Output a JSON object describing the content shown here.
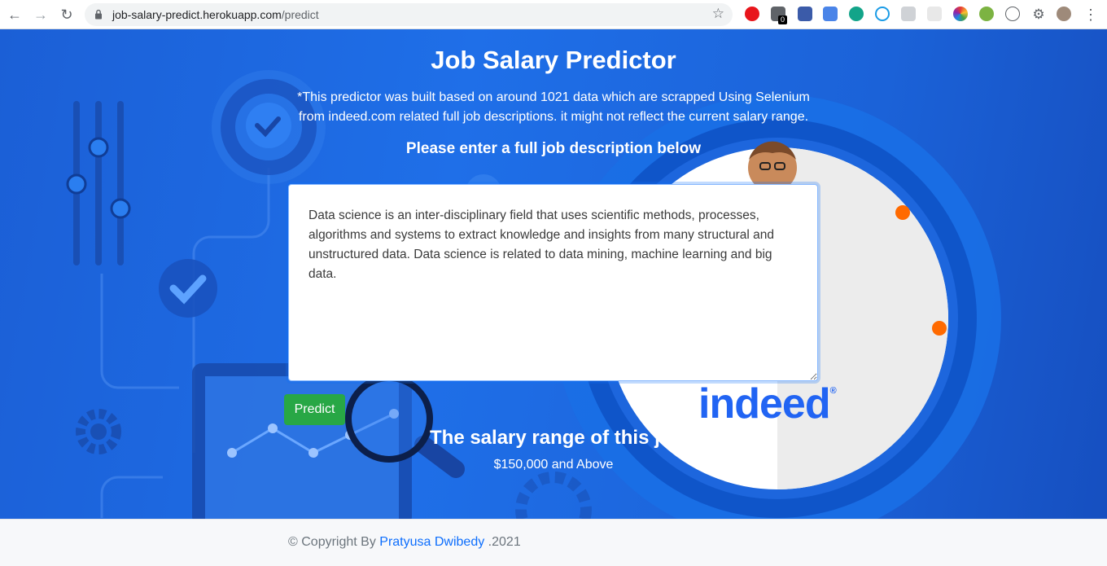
{
  "browser": {
    "url_host": "job-salary-predict.herokuapp.com",
    "url_path": "/predict",
    "extension_badge": "0"
  },
  "page": {
    "title": "Job Salary Predictor",
    "subtitle_line1": "*This predictor was built based on around 1021 data which are scrapped Using Selenium",
    "subtitle_line2": "from indeed.com related full job descriptions. it might not reflect the current salary range.",
    "prompt": "Please enter a full job description below",
    "job_description": "Data science is an inter-disciplinary field that uses scientific methods, processes, algorithms and systems to extract knowledge and insights from many structural and unstructured data. Data science is related to data mining, machine learning and big data.",
    "predict_label": "Predict",
    "result_heading": "The salary range of this j",
    "result_value": "$150,000 and Above",
    "logo_text": "indeed",
    "logo_mark": "®"
  },
  "footer": {
    "prefix": "© Copyright By ",
    "author": "Pratyusa Dwibedy",
    "suffix": " .2021"
  },
  "colors": {
    "hero": "#1f6fe8",
    "accent": "#0d6efd",
    "predict": "#28a745",
    "indeed": "#2164f3",
    "dots": "#ff6a00"
  }
}
